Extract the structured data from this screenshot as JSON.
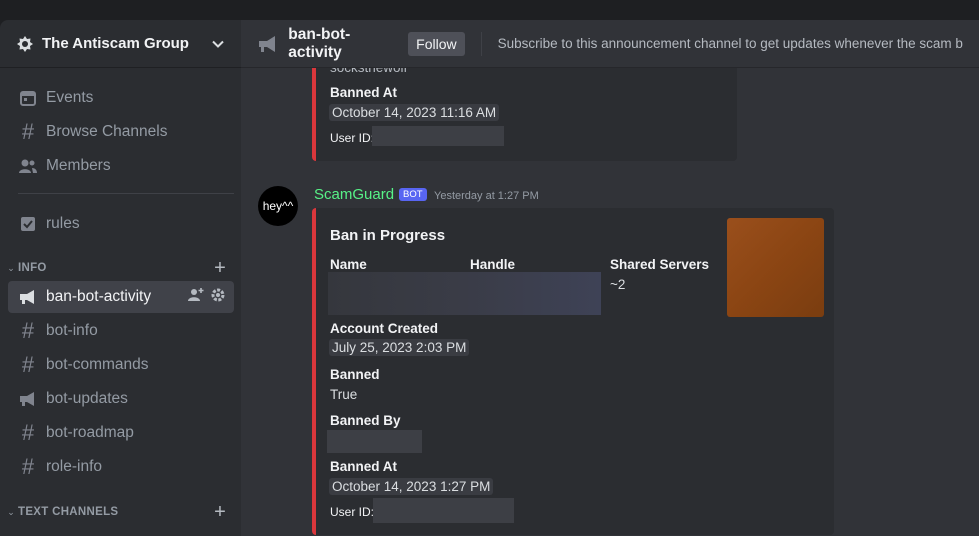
{
  "server": {
    "name": "The Antiscam Group"
  },
  "sidebar": {
    "top_items": [
      {
        "label": "Events",
        "icon": "calendar-icon"
      },
      {
        "label": "Browse Channels",
        "icon": "browse-channels-icon"
      },
      {
        "label": "Members",
        "icon": "members-icon"
      }
    ],
    "rules": {
      "label": "rules",
      "icon": "rules-icon"
    },
    "categories": [
      {
        "name": "INFO"
      },
      {
        "name": "TEXT CHANNELS"
      }
    ],
    "channels": [
      {
        "label": "ban-bot-activity",
        "icon": "announcement-icon"
      },
      {
        "label": "bot-info",
        "icon": "hash-icon"
      },
      {
        "label": "bot-commands",
        "icon": "hash-icon"
      },
      {
        "label": "bot-updates",
        "icon": "announcement-icon"
      },
      {
        "label": "bot-roadmap",
        "icon": "hash-icon"
      },
      {
        "label": "role-info",
        "icon": "hash-icon"
      }
    ]
  },
  "channel_header": {
    "title": "ban-bot-activity",
    "follow_label": "Follow",
    "topic": "Subscribe to this announcement channel to get updates whenever the scam b..."
  },
  "prev_embed": {
    "cut_text": "socksthewolf",
    "banned_at_label": "Banned At",
    "banned_at_value": "October 14, 2023 11:16 AM",
    "user_id_label": "User ID:"
  },
  "message": {
    "avatar_text": "hey^^",
    "username": "ScamGuard",
    "badge": "BOT",
    "timestamp": "Yesterday at 1:27 PM",
    "embed": {
      "title": "Ban in Progress",
      "name_label": "Name",
      "handle_label": "Handle",
      "shared_label": "Shared Servers",
      "shared_value": "~2",
      "created_label": "Account Created",
      "created_value": "July 25, 2023 2:03 PM",
      "banned_label": "Banned",
      "banned_value": "True",
      "banned_by_label": "Banned By",
      "banned_at_label": "Banned At",
      "banned_at_value": "October 14, 2023 1:27 PM",
      "user_id_label": "User ID:"
    }
  },
  "colors": {
    "accent_red": "#da373c",
    "bot_badge": "#5865f2",
    "username_green": "#57f287"
  }
}
